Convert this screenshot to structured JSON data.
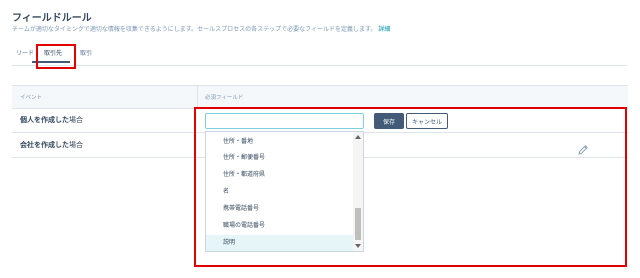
{
  "page": {
    "title": "フィールドルール",
    "subtitle": "チームが適切なタイミングで適切な情報を収集できるようにします。セールスプロセスの各ステップで必要なフィールドを定義します。",
    "details_link": "詳細"
  },
  "tabs": [
    {
      "label": "リード"
    },
    {
      "label": "取引先"
    },
    {
      "label": "取引"
    }
  ],
  "table": {
    "headers": {
      "event": "イベント",
      "required_fields": "必須フィールド"
    },
    "rows": [
      {
        "label_bold": "個人を作成した",
        "label_rest": "場合"
      },
      {
        "label_bold": "会社を作成した",
        "label_rest": "場合"
      }
    ]
  },
  "editor": {
    "input_value": "",
    "save_label": "保存",
    "cancel_label": "キャンセル"
  },
  "dropdown": {
    "items": [
      {
        "label": "住所・番地"
      },
      {
        "label": "住所・郵便番号"
      },
      {
        "label": "住所・都道府県"
      },
      {
        "label": "名"
      },
      {
        "label": "携帯電話番号"
      },
      {
        "label": "職場の電話番号"
      },
      {
        "label": "説明"
      }
    ],
    "highlighted_item": "説明"
  },
  "colors": {
    "primary_button": "#425b76",
    "focus_border": "#7fd1de",
    "annotation_red": "#e00000",
    "link": "#0091ae"
  },
  "icons": {
    "edit": "pencil-icon"
  }
}
